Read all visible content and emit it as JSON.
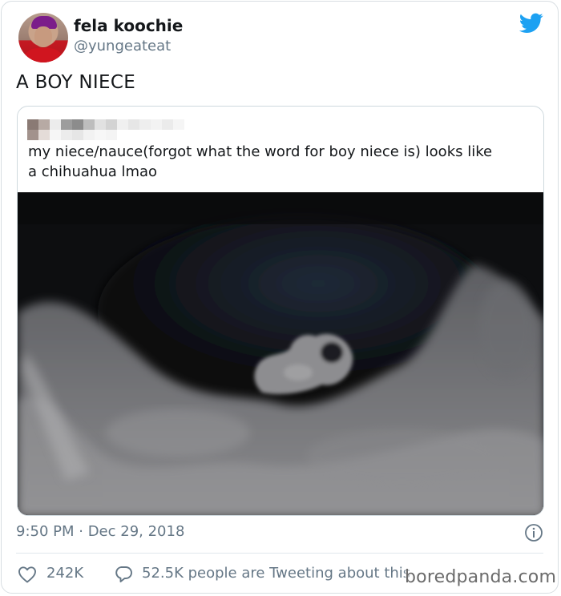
{
  "author": {
    "display_name": "fela koochie",
    "handle": "@yungeateat"
  },
  "tweet": {
    "text": "A BOY NIECE"
  },
  "quoted_tweet": {
    "text_line1": "my niece/nauce(forgot what the word for boy niece is) looks like",
    "text_line2": "a chihuahua lmao"
  },
  "meta": {
    "timestamp": "9:50 PM · Dec 29, 2018"
  },
  "actions": {
    "likes": "242K",
    "replies_text": "52.5K people are Tweeting about this"
  },
  "watermark": "boredpanda.com",
  "colors": {
    "twitter_blue": "#1da1f2",
    "secondary_text": "#657786"
  },
  "icons": [
    "twitter-bird-icon",
    "info-icon",
    "heart-icon",
    "reply-bubble-icon"
  ]
}
